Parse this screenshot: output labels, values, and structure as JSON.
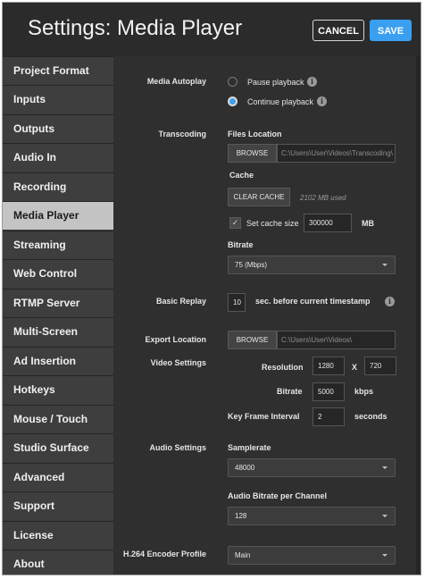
{
  "header": {
    "title": "Settings: Media Player",
    "cancel_label": "CANCEL",
    "save_label": "SAVE"
  },
  "colors": {
    "accent": "#3a9ff0",
    "active_nav": "#c4c4c4",
    "panel": "#2f2f2f",
    "sidebar": "#3e3e3e"
  },
  "sidebar": {
    "items": [
      {
        "label": "Project Format"
      },
      {
        "label": "Inputs"
      },
      {
        "label": "Outputs"
      },
      {
        "label": "Audio In"
      },
      {
        "label": "Recording"
      },
      {
        "label": "Media Player"
      },
      {
        "label": "Streaming"
      },
      {
        "label": "Web Control"
      },
      {
        "label": "RTMP Server"
      },
      {
        "label": "Multi-Screen"
      },
      {
        "label": "Ad Insertion"
      },
      {
        "label": "Hotkeys"
      },
      {
        "label": "Mouse / Touch"
      },
      {
        "label": "Studio Surface"
      },
      {
        "label": "Advanced"
      },
      {
        "label": "Support"
      },
      {
        "label": "License"
      },
      {
        "label": "About"
      }
    ],
    "active": "Media Player"
  },
  "media_autoplay": {
    "label": "Media Autoplay",
    "options": [
      "Pause playback",
      "Continue playback"
    ],
    "selected": "Continue playback"
  },
  "transcoding": {
    "label": "Transcoding",
    "files_location_label": "Files Location",
    "browse_label": "BROWSE",
    "files_path": "C:\\Users\\User\\Videos\\Transcoding\\",
    "cache_label": "Cache",
    "clear_cache_label": "CLEAR CACHE",
    "cache_used": "2102 MB used",
    "set_cache_size_label": "Set cache size",
    "set_cache_size_checked": true,
    "cache_size_value": "300000",
    "cache_size_unit": "MB",
    "bitrate_label": "Bitrate",
    "bitrate_value": "75 (Mbps)"
  },
  "basic_replay": {
    "label": "Basic Replay",
    "value": "10",
    "suffix": "sec. before current timestamp"
  },
  "export_location": {
    "label": "Export Location",
    "browse_label": "BROWSE",
    "path": "C:\\Users\\User\\Videos\\"
  },
  "video_settings": {
    "label": "Video Settings",
    "resolution_label": "Resolution",
    "width": "1280",
    "times": "X",
    "height": "720",
    "bitrate_label": "Bitrate",
    "bitrate_value": "5000",
    "bitrate_unit": "kbps",
    "keyframe_label": "Key Frame Interval",
    "keyframe_value": "2",
    "keyframe_unit": "seconds"
  },
  "audio_settings": {
    "label": "Audio Settings",
    "samplerate_label": "Samplerate",
    "samplerate_value": "48000",
    "audio_bitrate_label": "Audio Bitrate per Channel",
    "audio_bitrate_value": "128"
  },
  "encoder_profile": {
    "label": "H.264 Encoder Profile",
    "value": "Main"
  },
  "info_glyph": "i"
}
